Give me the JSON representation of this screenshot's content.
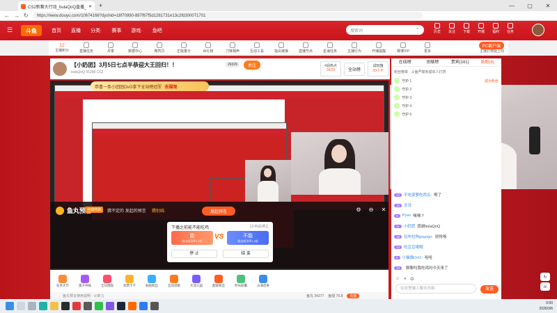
{
  "browser": {
    "tab_title": "CS2新赛大行动_bulaQoQ直播_bu",
    "url": "https://www.douyu.com/10674166?dyshid=18f70990-897f67f5d1281731e13c2fd300071701"
  },
  "nav": {
    "logo": "斗鱼",
    "items": [
      "首页",
      "直播",
      "分类·",
      "赛事",
      "游戏·",
      "鱼吧"
    ],
    "search_placeholder": "搜索词",
    "top_icons": [
      "历史",
      "关注",
      "下载",
      "开播",
      "福利",
      "任务"
    ]
  },
  "subbar": {
    "items": [
      "主播积分",
      "直播任务",
      "月季",
      "数据中心",
      "微司贝",
      "正能量分",
      "AI礼物",
      "刀锋相声",
      "互动工具",
      "指尖链接",
      "直播节点",
      "星海任务",
      "主播行为",
      "开播提醒",
      "赛博VIP",
      "更多"
    ],
    "score_label": "12",
    "pc_button": "PC客户端",
    "upload_link": "主播打榜能上线"
  },
  "room": {
    "title": "【小奶团】3月5日七点半恭迎大王回归！！",
    "hot": "26329",
    "follow_label": "关注",
    "meta": "bulaQoQ  55298  CS2",
    "rank_label": "4週热点",
    "rank_value": "16/25",
    "all_rank": "全站榜",
    "try_label": "试玩馆",
    "try_value": "20小卡"
  },
  "banner": {
    "text": "恭喜一条小团团OvO拿下全站榜冠军",
    "go": "去围观"
  },
  "prediction": {
    "title": "鱼丸预言",
    "tag": "自动开启",
    "desc": "猜不定的",
    "desc2": "发起的预言",
    "link": "猜别线·",
    "action_button": "发起预言",
    "question": "下播之前能不能吃鸡",
    "timer": "12:45后停止",
    "option_a": "能",
    "option_a_sub": "赔出成功率1.6倍",
    "option_b": "不能",
    "option_b_sub": "赔出成功率1.4倍",
    "vs": "VS",
    "stop": "停 止",
    "end": "结 束"
  },
  "toolbar": {
    "items": [
      "任务大厅",
      "量子共振",
      "全日围观",
      "亮票卡卡",
      "贴贴粉丝",
      "互动领取",
      "大话三国",
      "超级粉丝",
      "时光胶囊",
      "山海佳奇"
    ],
    "colors": [
      "#ff8a3c",
      "#a25cf5",
      "#ff4f6b",
      "#ffb32d",
      "#3bb0ff",
      "#ff7a1a",
      "#7b5cff",
      "#ff5d23",
      "#4ec27c",
      "#3a8ee6"
    ]
  },
  "bottom": {
    "notice": "鱼丸预言使用说明 · 火箭 ()",
    "stats": [
      "鱼丸 34277",
      "鱼翅 75.8",
      "充值"
    ]
  },
  "side": {
    "tabs": [
      "在线榜",
      "贡献榜",
      "贵宾(161)",
      "贴粉(6)"
    ],
    "fans_label": "粉丝榜单",
    "fans_hint": "斗鱼严禁未成年人打赏",
    "ranks": [
      {
        "name": "守护 1",
        "tag": "成为粉丝"
      },
      {
        "name": "守护 2",
        "tag": ""
      },
      {
        "name": "守护 3",
        "tag": ""
      },
      {
        "name": "守护 4",
        "tag": ""
      },
      {
        "name": "守护 5",
        "tag": ""
      }
    ]
  },
  "chat": {
    "messages": [
      {
        "lv": "12",
        "name": "不吃菠萝吃西瓜:",
        "text": "啊了"
      },
      {
        "lv": "15",
        "name": "牙牙:",
        "text": ""
      },
      {
        "lv": "9",
        "name": "Pyan",
        "text": "嘿嘿 ?"
      },
      {
        "lv": "11",
        "name": "小奶团",
        "text": "感谢bulaQoQ"
      },
      {
        "lv": "19",
        "name": "拉布拉狗gogogo:",
        "text": "别抢咯"
      },
      {
        "lv": "13",
        "name": "吃豆豆哦哦:",
        "text": ""
      },
      {
        "lv": "8",
        "name": "小猫猫OvO:",
        "text": "哈哈"
      },
      {
        "lv": "10",
        "name": "",
        "text": "聊聊吗我吃鸡吗今天来了"
      }
    ],
    "input_placeholder": "在这里输入聊天内容",
    "send": "发送"
  },
  "taskbar": {
    "time": "0:00",
    "date": "2026/3/6"
  }
}
